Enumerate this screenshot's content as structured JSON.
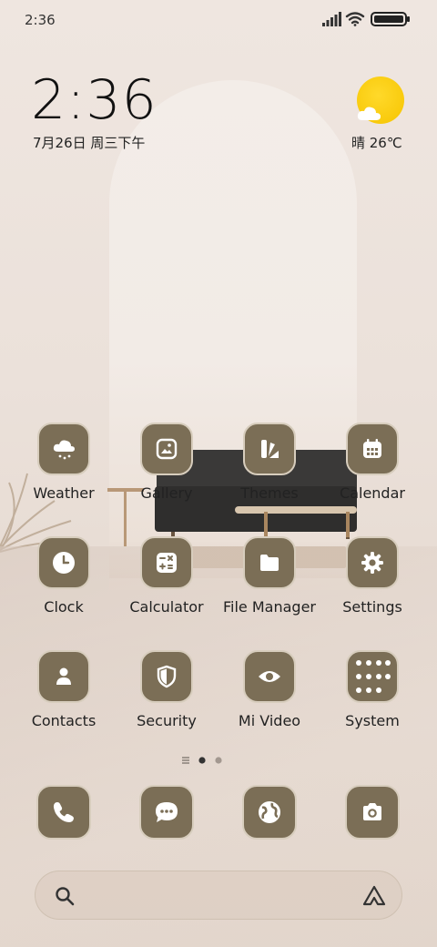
{
  "status_bar": {
    "time": "2:36",
    "icons": [
      "signal-icon",
      "wifi-icon",
      "battery-icon"
    ]
  },
  "clock_widget": {
    "time": "2:36",
    "date": "7月26日 周三下午"
  },
  "weather_widget": {
    "condition_icon": "sunny-cloud-icon",
    "text": "晴 26℃"
  },
  "apps": [
    {
      "label": "Weather",
      "icon": "weather-icon"
    },
    {
      "label": "Gallery",
      "icon": "gallery-icon"
    },
    {
      "label": "Themes",
      "icon": "themes-icon"
    },
    {
      "label": "Calendar",
      "icon": "calendar-icon"
    },
    {
      "label": "Clock",
      "icon": "clock-icon"
    },
    {
      "label": "Calculator",
      "icon": "calculator-icon"
    },
    {
      "label": "File Manager",
      "icon": "folder-icon"
    },
    {
      "label": "Settings",
      "icon": "gear-icon"
    },
    {
      "label": "Contacts",
      "icon": "person-icon"
    },
    {
      "label": "Security",
      "icon": "shield-icon"
    },
    {
      "label": "Mi Video",
      "icon": "eye-icon"
    },
    {
      "label": "System",
      "icon": "folder-grid-icon"
    }
  ],
  "page_indicator": {
    "pages": 2,
    "current": 1
  },
  "dock": [
    {
      "icon": "phone-icon"
    },
    {
      "icon": "message-icon"
    },
    {
      "icon": "browser-globe-icon"
    },
    {
      "icon": "camera-icon"
    }
  ],
  "search_bar": {
    "left_icon": "search-icon",
    "right_icon": "assistant-icon"
  },
  "colors": {
    "icon_tile": "#7b6e56",
    "icon_border": "#d7cdbd",
    "sun": "#f6c400"
  }
}
